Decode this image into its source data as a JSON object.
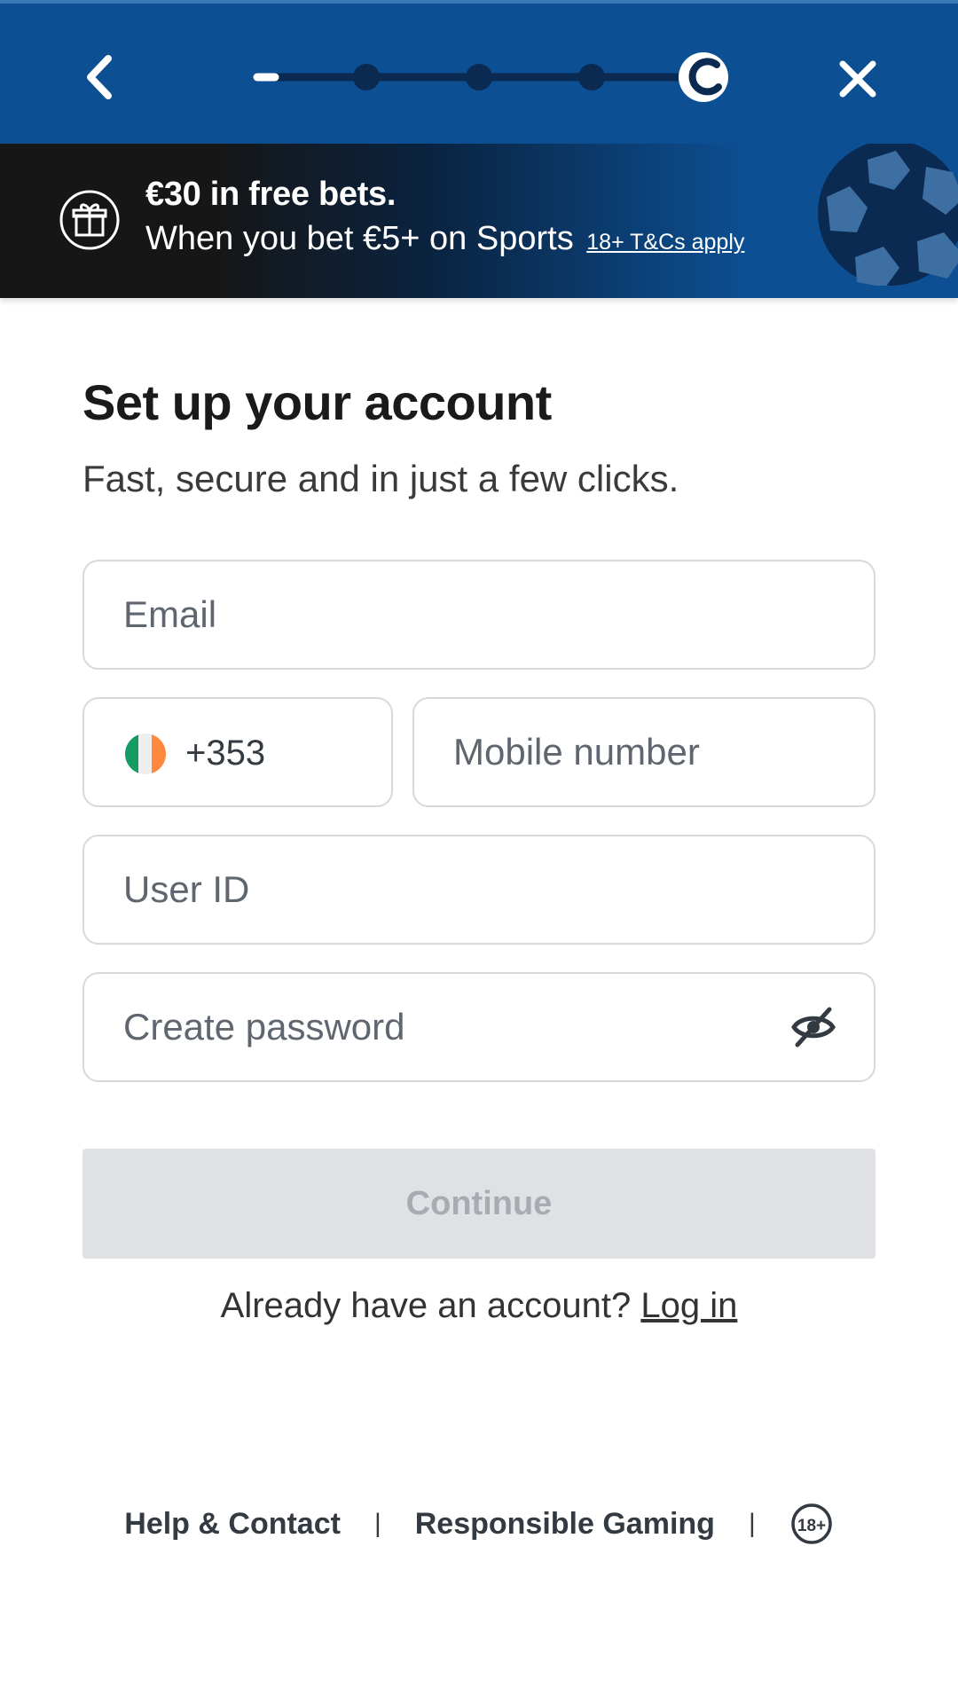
{
  "header": {
    "back_icon": "chevron-left-icon",
    "close_icon": "close-icon",
    "brand_icon": "coral-logo-icon",
    "stepper": {
      "total_steps": 5,
      "current_step": 1
    }
  },
  "promo": {
    "icon": "gift-icon",
    "title": "€30 in free bets.",
    "subtitle": "When you bet €5+ on Sports",
    "terms_link": "18+ T&Cs apply",
    "decor_icon": "football-icon"
  },
  "form": {
    "title": "Set up your account",
    "subtitle": "Fast, secure and in just a few clicks.",
    "email": {
      "placeholder": "Email",
      "value": ""
    },
    "country": {
      "flag_icon": "ireland-flag-icon",
      "dial_code": "+353"
    },
    "mobile": {
      "placeholder": "Mobile number",
      "value": ""
    },
    "user_id": {
      "placeholder": "User ID",
      "value": ""
    },
    "password": {
      "placeholder": "Create password",
      "value": "",
      "toggle_icon": "eye-off-icon"
    },
    "continue_label": "Continue"
  },
  "login": {
    "prompt": "Already have an account?",
    "link": "Log in"
  },
  "footer": {
    "help": "Help & Contact",
    "responsible": "Responsible Gaming",
    "separator": "|",
    "age_badge": "18+"
  },
  "colors": {
    "header_blue": "#0c4f93",
    "banner_dark": "#161616",
    "disabled_button": "#dfe1e4",
    "disabled_text": "#a7acb2"
  }
}
